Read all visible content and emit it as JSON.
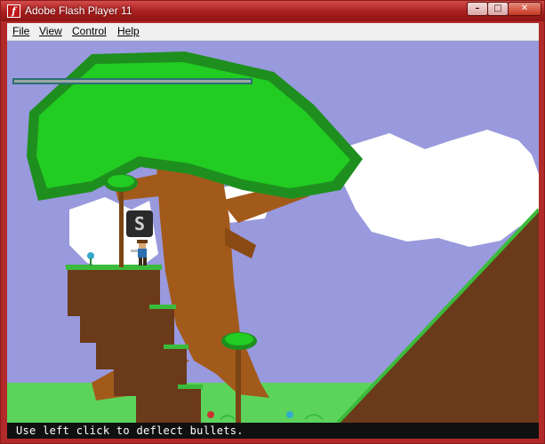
{
  "window": {
    "title": "Adobe Flash Player 11",
    "app_icon": "flash-icon",
    "app_icon_glyph": "f",
    "controls": {
      "minimize": "–",
      "maximize": "□",
      "close": "✕"
    }
  },
  "menu": {
    "items": [
      "File",
      "View",
      "Control",
      "Help"
    ]
  },
  "game": {
    "key_prompt": "S",
    "hint": "Use left click to deflect bullets.",
    "health_bar_fill": 1.0,
    "colors": {
      "sky": "#9999dd",
      "leaves": "#22cc22",
      "leaves_edge": "#1e8f1e",
      "trunk": "#a25a1a",
      "ground": "#6b3a1a",
      "grass": "#3bbb3b",
      "cloud": "#ffffff",
      "hint_bar": "#101010"
    }
  }
}
